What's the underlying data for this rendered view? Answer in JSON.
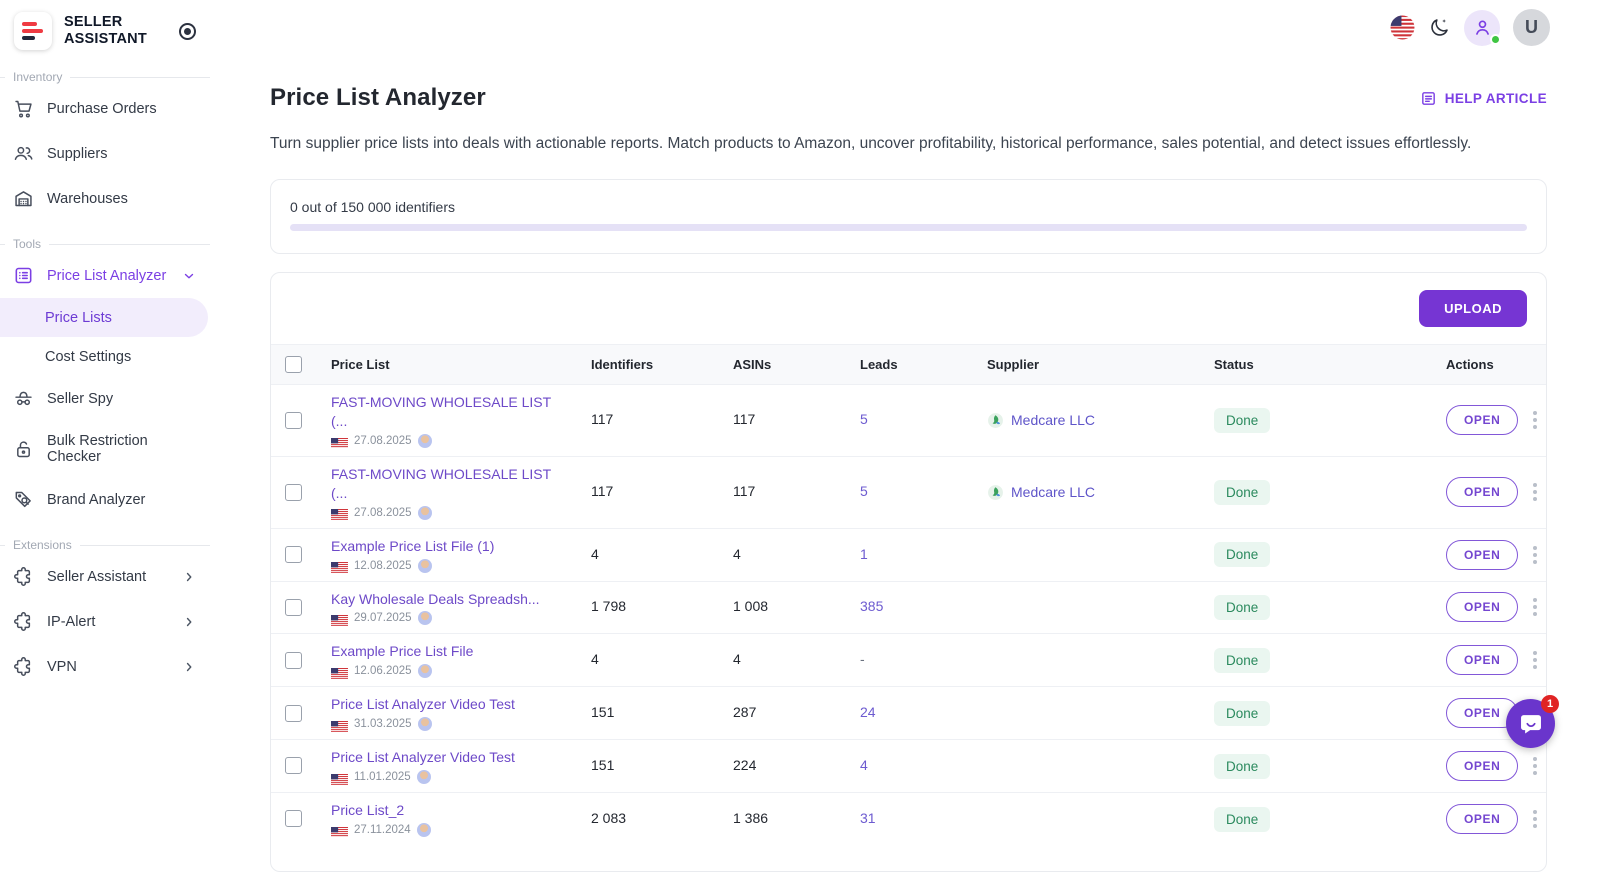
{
  "brand": {
    "line1": "SELLER",
    "line2": "ASSISTANT"
  },
  "sidebar": {
    "section_inventory": "Inventory",
    "item_purchase_orders": "Purchase Orders",
    "item_suppliers": "Suppliers",
    "item_warehouses": "Warehouses",
    "section_tools": "Tools",
    "item_price_list_analyzer": "Price List Analyzer",
    "item_price_lists": "Price Lists",
    "item_cost_settings": "Cost Settings",
    "item_seller_spy": "Seller Spy",
    "item_bulk_restriction_checker": "Bulk Restriction Checker",
    "item_brand_analyzer": "Brand Analyzer",
    "section_extensions": "Extensions",
    "item_seller_assistant": "Seller Assistant",
    "item_ip_alert": "IP-Alert",
    "item_vpn": "VPN"
  },
  "topbar": {
    "avatar_initial": "U"
  },
  "header": {
    "title": "Price List Analyzer",
    "help_link": "HELP ARTICLE",
    "description": "Turn supplier price lists into deals with actionable reports. Match products to Amazon, uncover profitability, historical performance, sales potential, and detect issues effortlessly."
  },
  "usage": {
    "label": "0 out of 150 000 identifiers",
    "progress_percent": 0
  },
  "toolbar": {
    "upload_label": "UPLOAD"
  },
  "table": {
    "columns": [
      "Price List",
      "Identifiers",
      "ASINs",
      "Leads",
      "Supplier",
      "Status",
      "Actions"
    ],
    "open_label": "OPEN",
    "rows": [
      {
        "name": "FAST-MOVING WHOLESALE LIST (...",
        "date": "27.08.2025",
        "identifiers": "117",
        "asins": "117",
        "leads": "5",
        "supplier": "Medcare LLC",
        "status": "Done"
      },
      {
        "name": "FAST-MOVING WHOLESALE LIST (...",
        "date": "27.08.2025",
        "identifiers": "117",
        "asins": "117",
        "leads": "5",
        "supplier": "Medcare LLC",
        "status": "Done"
      },
      {
        "name": "Example Price List File (1)",
        "date": "12.08.2025",
        "identifiers": "4",
        "asins": "4",
        "leads": "1",
        "supplier": "",
        "status": "Done"
      },
      {
        "name": "Kay Wholesale Deals Spreadsh...",
        "date": "29.07.2025",
        "identifiers": "1 798",
        "asins": "1 008",
        "leads": "385",
        "supplier": "",
        "status": "Done"
      },
      {
        "name": "Example Price List File",
        "date": "12.06.2025",
        "identifiers": "4",
        "asins": "4",
        "leads": "-",
        "supplier": "",
        "status": "Done"
      },
      {
        "name": "Price List Analyzer Video Test",
        "date": "31.03.2025",
        "identifiers": "151",
        "asins": "287",
        "leads": "24",
        "supplier": "",
        "status": "Done"
      },
      {
        "name": "Price List Analyzer Video Test",
        "date": "11.01.2025",
        "identifiers": "151",
        "asins": "224",
        "leads": "4",
        "supplier": "",
        "status": "Done"
      },
      {
        "name": "Price List_2",
        "date": "27.11.2024",
        "identifiers": "2 083",
        "asins": "1 386",
        "leads": "31",
        "supplier": "",
        "status": "Done"
      }
    ]
  },
  "chat": {
    "badge": "1"
  },
  "colors": {
    "accent": "#7635d3",
    "link": "#6d49c8",
    "done_bg": "#eaf6f0",
    "done_text": "#2b8a5e",
    "badge_red": "#e02424",
    "logo_red": "#ef3b42"
  }
}
